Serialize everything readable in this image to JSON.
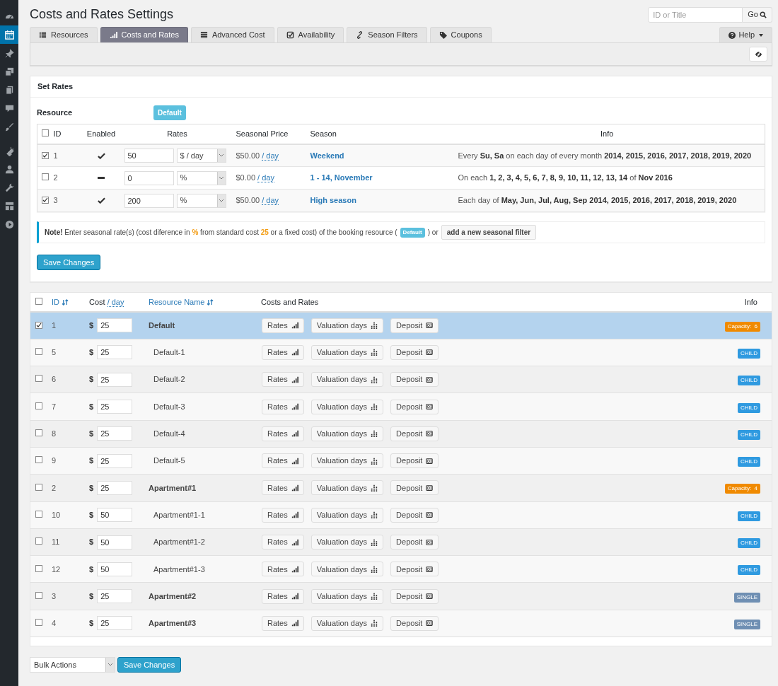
{
  "sidebar": {
    "items": [
      {
        "selected": false
      },
      {
        "selected": true
      },
      {
        "selected": false
      },
      {
        "selected": false
      },
      {
        "selected": false
      },
      {
        "selected": false
      },
      {
        "selected": false
      },
      {
        "selected": false
      },
      {
        "selected": false
      },
      {
        "selected": false
      },
      {
        "selected": false
      },
      {
        "selected": false
      }
    ]
  },
  "page_title": "Costs and Rates Settings",
  "search": {
    "placeholder": "ID or Title",
    "button": "Go"
  },
  "tabs": [
    {
      "label": "Resources",
      "selected": false
    },
    {
      "label": "Costs and Rates",
      "selected": true
    },
    {
      "label": "Advanced Cost",
      "selected": false
    },
    {
      "label": "Availability",
      "selected": false
    },
    {
      "label": "Season Filters",
      "selected": false
    },
    {
      "label": "Coupons",
      "selected": false
    }
  ],
  "help_tab": {
    "label": "Help"
  },
  "set_rates": {
    "title": "Set Rates",
    "resource_label": "Resource",
    "resource_badge": "Default",
    "all_checked": false,
    "columns": [
      "ID",
      "Enabled",
      "Rates",
      "Seasonal Price",
      "Season",
      "Info"
    ],
    "rows": [
      {
        "checked": true,
        "id": "1",
        "enabled": true,
        "rate": "50",
        "unit": "$ / day",
        "price": "$50.00",
        "price_unit": "/ day",
        "season": "Weekend",
        "info": "Every **Su, Sa** on each day of every month **2014, 2015, 2016, 2017, 2018, 2019, 2020**"
      },
      {
        "checked": false,
        "id": "2",
        "enabled": false,
        "rate": "0",
        "unit": "%",
        "price": "$0.00",
        "price_unit": "/ day",
        "season": "1 - 14, November",
        "info": "On each **1, 2, 3, 4, 5, 6, 7, 8, 9, 10, 11, 12, 13, 14** of **Nov 2016**"
      },
      {
        "checked": true,
        "id": "3",
        "enabled": true,
        "rate": "200",
        "unit": "%",
        "price": "$50.00",
        "price_unit": "/ day",
        "season": "High season",
        "info": "Each day of **May, Jun, Jul, Aug, Sep 2014, 2015, 2016, 2017, 2018, 2019, 2020**"
      }
    ],
    "note": {
      "segments": [
        {
          "kind": "bold",
          "text": "Note!"
        },
        {
          "kind": "plain",
          "text": " Enter seasonal rate(s) (cost diference in "
        },
        {
          "kind": "highlight",
          "text": "%"
        },
        {
          "kind": "plain",
          "text": " from standard cost "
        },
        {
          "kind": "highlight",
          "text": "25"
        },
        {
          "kind": "plain",
          "text": " or a fixed cost) of the booking resource ("
        }
      ],
      "badge": "Default",
      "after": ") or",
      "button": "add a new seasonal filter"
    },
    "save_button": "Save Changes"
  },
  "resources": {
    "all_checked": false,
    "columns": {
      "id": "ID",
      "cost": "Cost",
      "cost_unit": "/ day",
      "name": "Resource Name",
      "rates": "Costs and Rates",
      "info": "Info"
    },
    "rows": [
      {
        "checked": true,
        "selected": true,
        "id": "1",
        "currency": "$",
        "cost": "25",
        "name": "Default",
        "buttons": [
          "Rates",
          "Valuation days",
          "Deposit"
        ],
        "badge": {
          "kind": "capacity",
          "text": "Capacity:  6"
        },
        "children": [
          {
            "checked": false,
            "selected": false,
            "id": "5",
            "currency": "$",
            "cost": "25",
            "name": "Default-1",
            "buttons": [
              "Rates",
              "Valuation days",
              "Deposit"
            ],
            "badge": {
              "kind": "child",
              "text": "CHILD"
            }
          },
          {
            "checked": false,
            "selected": false,
            "id": "6",
            "currency": "$",
            "cost": "25",
            "name": "Default-2",
            "buttons": [
              "Rates",
              "Valuation days",
              "Deposit"
            ],
            "badge": {
              "kind": "child",
              "text": "CHILD"
            }
          },
          {
            "checked": false,
            "selected": false,
            "id": "7",
            "currency": "$",
            "cost": "25",
            "name": "Default-3",
            "buttons": [
              "Rates",
              "Valuation days",
              "Deposit"
            ],
            "badge": {
              "kind": "child",
              "text": "CHILD"
            }
          },
          {
            "checked": false,
            "selected": false,
            "id": "8",
            "currency": "$",
            "cost": "25",
            "name": "Default-4",
            "buttons": [
              "Rates",
              "Valuation days",
              "Deposit"
            ],
            "badge": {
              "kind": "child",
              "text": "CHILD"
            }
          },
          {
            "checked": false,
            "selected": false,
            "id": "9",
            "currency": "$",
            "cost": "25",
            "name": "Default-5",
            "buttons": [
              "Rates",
              "Valuation days",
              "Deposit"
            ],
            "badge": {
              "kind": "child",
              "text": "CHILD"
            }
          }
        ]
      },
      {
        "checked": false,
        "selected": false,
        "id": "2",
        "currency": "$",
        "cost": "25",
        "name": "Apartment#1",
        "buttons": [
          "Rates",
          "Valuation days",
          "Deposit"
        ],
        "badge": {
          "kind": "capacity",
          "text": "Capacity:  4"
        },
        "children": [
          {
            "checked": false,
            "selected": false,
            "id": "10",
            "currency": "$",
            "cost": "50",
            "name": "Apartment#1-1",
            "buttons": [
              "Rates",
              "Valuation days",
              "Deposit"
            ],
            "badge": {
              "kind": "child",
              "text": "CHILD"
            }
          },
          {
            "checked": false,
            "selected": false,
            "id": "11",
            "currency": "$",
            "cost": "50",
            "name": "Apartment#1-2",
            "buttons": [
              "Rates",
              "Valuation days",
              "Deposit"
            ],
            "badge": {
              "kind": "child",
              "text": "CHILD"
            }
          },
          {
            "checked": false,
            "selected": false,
            "id": "12",
            "currency": "$",
            "cost": "50",
            "name": "Apartment#1-3",
            "buttons": [
              "Rates",
              "Valuation days",
              "Deposit"
            ],
            "badge": {
              "kind": "child",
              "text": "CHILD"
            }
          }
        ]
      },
      {
        "checked": false,
        "selected": false,
        "id": "3",
        "currency": "$",
        "cost": "25",
        "name": "Apartment#2",
        "buttons": [
          "Rates",
          "Valuation days",
          "Deposit"
        ],
        "badge": {
          "kind": "single",
          "text": "SINGLE"
        }
      },
      {
        "checked": false,
        "selected": false,
        "id": "4",
        "currency": "$",
        "cost": "25",
        "name": "Apartment#3",
        "buttons": [
          "Rates",
          "Valuation days",
          "Deposit"
        ],
        "badge": {
          "kind": "single",
          "text": "SINGLE"
        }
      }
    ]
  },
  "bulk_actions": {
    "value": "Bulk Actions"
  },
  "bottom_save_button": "Save Changes"
}
